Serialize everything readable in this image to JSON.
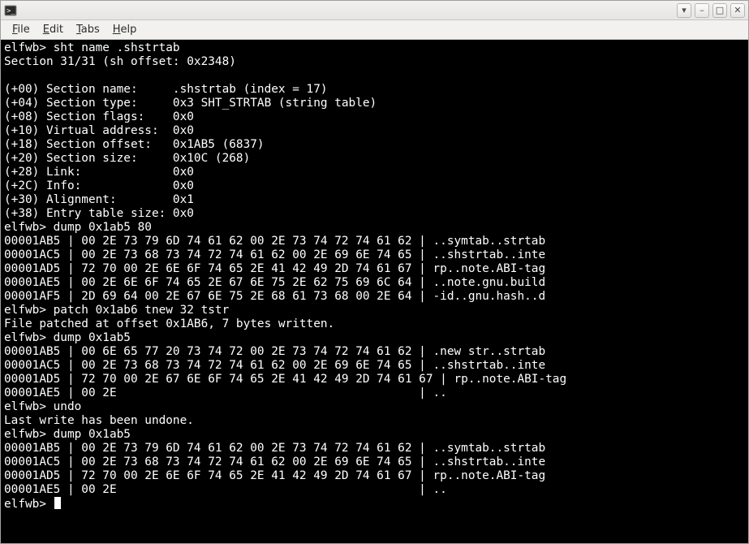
{
  "titlebar": {
    "icon_name": "terminal-icon"
  },
  "window_buttons": {
    "down": "▾",
    "min": "–",
    "max": "□",
    "close": "✕"
  },
  "menu": {
    "file": {
      "ul": "F",
      "rest": "ile"
    },
    "edit": {
      "ul": "E",
      "rest": "dit"
    },
    "tabs": {
      "ul": "T",
      "rest": "abs"
    },
    "help": {
      "ul": "H",
      "rest": "elp"
    }
  },
  "terminal": {
    "prompt": "elfwb>",
    "lines": [
      "elfwb> sht name .shstrtab",
      "Section 31/31 (sh offset: 0x2348)",
      "",
      "(+00) Section name:     .shstrtab (index = 17)",
      "(+04) Section type:     0x3 SHT_STRTAB (string table)",
      "(+08) Section flags:    0x0",
      "(+10) Virtual address:  0x0",
      "(+18) Section offset:   0x1AB5 (6837)",
      "(+20) Section size:     0x10C (268)",
      "(+28) Link:             0x0",
      "(+2C) Info:             0x0",
      "(+30) Alignment:        0x1",
      "(+38) Entry table size: 0x0",
      "elfwb> dump 0x1ab5 80",
      "00001AB5 | 00 2E 73 79 6D 74 61 62 00 2E 73 74 72 74 61 62 | ..symtab..strtab",
      "00001AC5 | 00 2E 73 68 73 74 72 74 61 62 00 2E 69 6E 74 65 | ..shstrtab..inte",
      "00001AD5 | 72 70 00 2E 6E 6F 74 65 2E 41 42 49 2D 74 61 67 | rp..note.ABI-tag",
      "00001AE5 | 00 2E 6E 6F 74 65 2E 67 6E 75 2E 62 75 69 6C 64 | ..note.gnu.build",
      "00001AF5 | 2D 69 64 00 2E 67 6E 75 2E 68 61 73 68 00 2E 64 | -id..gnu.hash..d",
      "elfwb> patch 0x1ab6 tnew 32 tstr",
      "File patched at offset 0x1AB6, 7 bytes written.",
      "elfwb> dump 0x1ab5",
      "00001AB5 | 00 6E 65 77 20 73 74 72 00 2E 73 74 72 74 61 62 | .new str..strtab",
      "00001AC5 | 00 2E 73 68 73 74 72 74 61 62 00 2E 69 6E 74 65 | ..shstrtab..inte",
      "00001AD5 | 72 70 00 2E 67 6E 6F 74 65 2E 41 42 49 2D 74 61 67 | rp..note.ABI-tag",
      "00001AE5 | 00 2E                                           | ..",
      "elfwb> undo",
      "Last write has been undone.",
      "elfwb> dump 0x1ab5",
      "00001AB5 | 00 2E 73 79 6D 74 61 62 00 2E 73 74 72 74 61 62 | ..symtab..strtab",
      "00001AC5 | 00 2E 73 68 73 74 72 74 61 62 00 2E 69 6E 74 65 | ..shstrtab..inte",
      "00001AD5 | 72 70 00 2E 6E 6F 74 65 2E 41 42 49 2D 74 61 67 | rp..note.ABI-tag",
      "00001AE5 | 00 2E                                           | ..",
      "elfwb> "
    ]
  }
}
